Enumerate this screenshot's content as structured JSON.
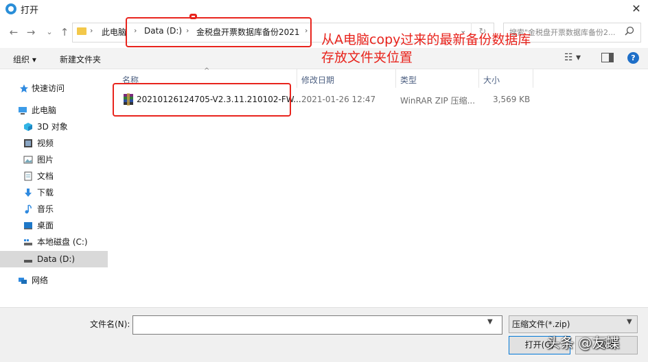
{
  "window": {
    "title": "打开",
    "close": "✕"
  },
  "nav": {
    "back": "←",
    "forward": "→",
    "recent": "⌄",
    "up": "↑"
  },
  "address": {
    "crumbs": [
      "此电脑",
      "Data (D:)",
      "金税盘开票数据库备份2021"
    ],
    "sep": "›",
    "dropdown": "⌄",
    "refresh": "↻"
  },
  "search": {
    "placeholder": "搜索\"金税盘开票数据库备份2...",
    "icon": "search-icon"
  },
  "toolbar": {
    "organize": "组织 ▾",
    "new_folder": "新建文件夹",
    "view": "☷ ▾",
    "help": "?"
  },
  "sidebar": {
    "items": [
      {
        "label": "快速访问",
        "icon": "star-icon"
      },
      {
        "label": "此电脑",
        "icon": "computer-icon"
      },
      {
        "label": "3D 对象",
        "icon": "cube-icon"
      },
      {
        "label": "视频",
        "icon": "video-icon"
      },
      {
        "label": "图片",
        "icon": "picture-icon"
      },
      {
        "label": "文档",
        "icon": "document-icon"
      },
      {
        "label": "下载",
        "icon": "download-icon"
      },
      {
        "label": "音乐",
        "icon": "music-icon"
      },
      {
        "label": "桌面",
        "icon": "desktop-icon"
      },
      {
        "label": "本地磁盘 (C:)",
        "icon": "drive-icon"
      },
      {
        "label": "Data (D:)",
        "icon": "drive-icon"
      },
      {
        "label": "网络",
        "icon": "network-icon"
      }
    ]
  },
  "columns": {
    "name": "名称",
    "date": "修改日期",
    "type": "类型",
    "size": "大小"
  },
  "files": [
    {
      "name": "20210126124705-V2.3.11.210102-FW...",
      "date": "2021-01-26 12:47",
      "type": "WinRAR ZIP 压缩...",
      "size": "3,569 KB"
    }
  ],
  "bottom": {
    "filename_label": "文件名(N):",
    "filename_value": "",
    "filetype": "压缩文件(*.zip)",
    "open": "打开(O)",
    "cancel": "取消"
  },
  "annotation": {
    "line1": "从A电脑copy过来的最新备份数据库",
    "line2": "存放文件夹位置"
  },
  "watermark": "头条 @友蝶",
  "colors": {
    "accent": "#0078d7",
    "annotation": "#e8231c",
    "folder": "#f3c84a"
  }
}
